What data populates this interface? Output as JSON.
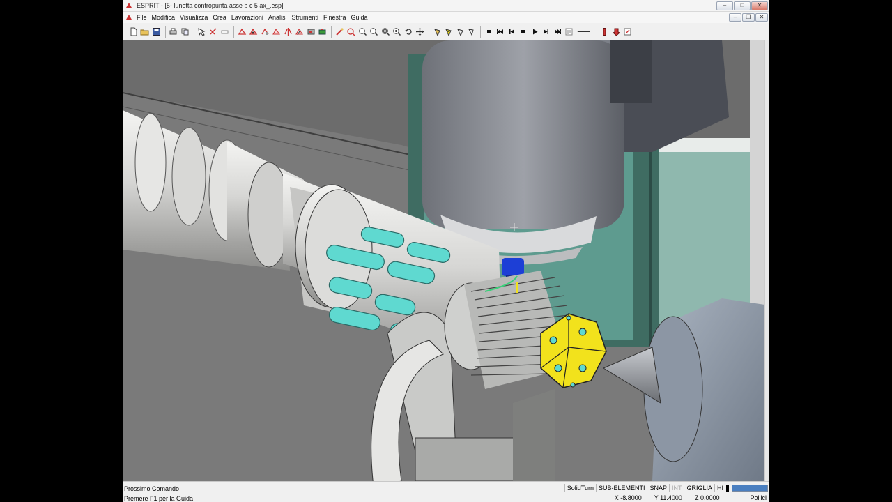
{
  "window": {
    "title": "ESPRIT - [5- lunetta contropunta asse b c 5 ax_.esp]"
  },
  "menu": {
    "items": [
      "File",
      "Modifica",
      "Visualizza",
      "Crea",
      "Lavorazioni",
      "Analisi",
      "Strumenti",
      "Finestra",
      "Guida"
    ]
  },
  "toolbar": {
    "icons": [
      "new-file-icon",
      "open-folder-icon",
      "save-icon",
      "print-icon",
      "copy-icon",
      "select-icon",
      "trim-icon",
      "eraser-icon",
      "layer-icon",
      "transform-icon",
      "group-icon",
      "feature-icon",
      "mirror-icon",
      "copy-feature-icon",
      "machine-icon",
      "tool-icon",
      "settings-icon",
      "redraw-icon",
      "zoom-in-icon",
      "zoom-out-icon",
      "zoom-window-icon",
      "zoom-extents-icon",
      "rotate-icon",
      "pan-icon",
      "shade-icon",
      "shade-solid-icon",
      "wireframe-icon",
      "view-cube-icon",
      "stop-icon",
      "rewind-icon",
      "step-back-icon",
      "pause-icon",
      "play-icon",
      "step-forward-icon",
      "fast-forward-icon",
      "simulation-settings-icon",
      "line-icon",
      "tool-path-icon",
      "clamp-icon",
      "close-simulation-icon"
    ]
  },
  "status": {
    "command_label": "Prossimo Comando",
    "help_hint": "Premere F1 per la Guida",
    "indicators": [
      "SolidTurn",
      "SUB-ELEMENTI",
      "SNAP",
      "INT",
      "GRIGLIA",
      "HI"
    ],
    "x": "X -8.8000",
    "y": "Y 11.4000",
    "z": "Z 0.0000",
    "units": "Pollici",
    "progress": 1.0
  },
  "colors": {
    "accent_cyan": "#5fd9d0",
    "accent_yellow": "#f2e21c",
    "spindle_blue": "#1d3fd6"
  }
}
